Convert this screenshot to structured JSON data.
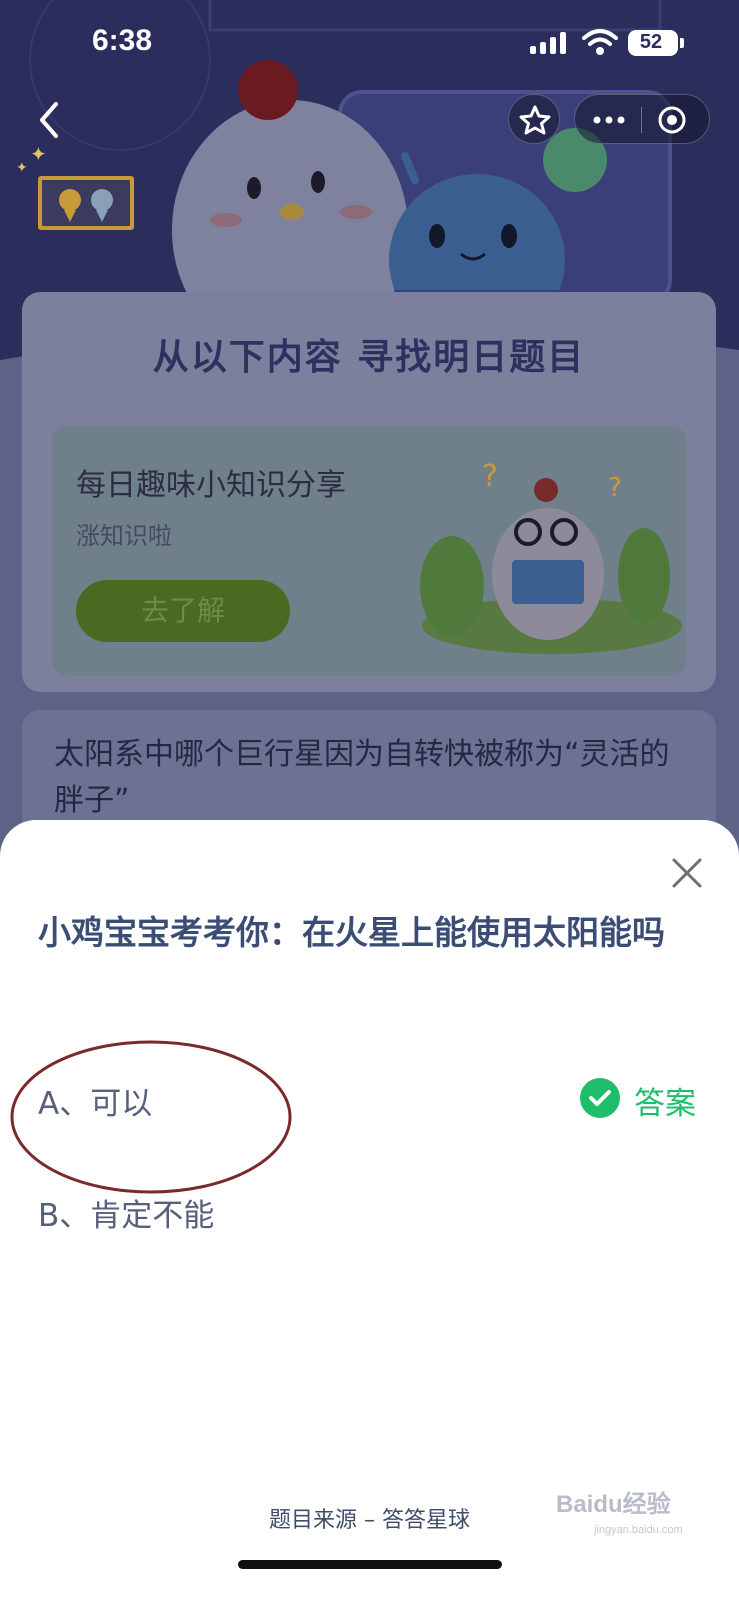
{
  "status_bar": {
    "time": "6:38",
    "battery": "52"
  },
  "background": {
    "card_title": "从以下内容  寻找明日题目",
    "knowledge": {
      "title": "每日趣味小知识分享",
      "subtitle": "涨知识啦",
      "button": "去了解"
    },
    "question_card": {
      "text": "太阳系中哪个巨行星因为自转快被称为“灵活的胖子”"
    }
  },
  "sheet": {
    "question": "小鸡宝宝考考你：在火星上能使用太阳能吗",
    "options": [
      {
        "label": "A、可以"
      },
      {
        "label": "B、肯定不能"
      }
    ],
    "answer_label": "答案",
    "footer": "题目来源 – 答答星球"
  },
  "watermark": {
    "brand": "Baidu经验",
    "url": "jingyan.baidu.com"
  },
  "colors": {
    "accent_green": "#1fbe6c",
    "question_blue": "#3b4d74",
    "annotation_red": "#7a2a2a"
  }
}
